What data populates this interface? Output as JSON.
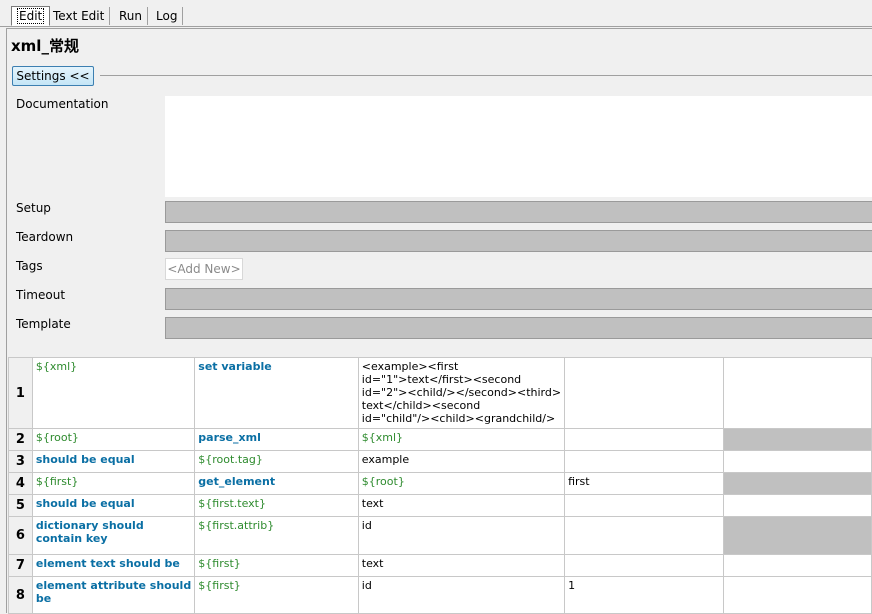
{
  "tabs": [
    {
      "label": "Edit",
      "active": true
    },
    {
      "label": "Text Edit",
      "active": false
    },
    {
      "label": "Run",
      "active": false
    },
    {
      "label": "Log",
      "active": false
    }
  ],
  "title": "xml_常规",
  "settings_button": "Settings <<",
  "fields": {
    "documentation": "Documentation",
    "setup": "Setup",
    "teardown": "Teardown",
    "tags": "Tags",
    "tags_placeholder": "<Add New>",
    "timeout": "Timeout",
    "template": "Template"
  },
  "colors": {
    "variable": "#2e8b2e",
    "keyword": "#0a6fa4",
    "empty_cell": "#c0c0c0"
  },
  "grid": {
    "rows": [
      {
        "num": "1",
        "cells": [
          {
            "text": "${xml}",
            "kind": "var"
          },
          {
            "text": "set variable",
            "kind": "kw"
          },
          {
            "text": "<example><first\nid=\"1\">text</first><second\nid=\"2\"><child/></second><third>\ntext</child><second\nid=\"child\"/><child><grandchild/>",
            "kind": "plain"
          },
          {
            "text": "",
            "kind": "empty"
          },
          {
            "text": "",
            "kind": "empty"
          }
        ]
      },
      {
        "num": "2",
        "cells": [
          {
            "text": "${root}",
            "kind": "var"
          },
          {
            "text": "parse_xml",
            "kind": "kw"
          },
          {
            "text": "${xml}",
            "kind": "var"
          },
          {
            "text": "",
            "kind": "empty"
          },
          {
            "text": "",
            "kind": "gray"
          }
        ]
      },
      {
        "num": "3",
        "cells": [
          {
            "text": "should be equal",
            "kind": "kw"
          },
          {
            "text": "${root.tag}",
            "kind": "var"
          },
          {
            "text": "example",
            "kind": "plain"
          },
          {
            "text": "",
            "kind": "empty"
          },
          {
            "text": "",
            "kind": "empty"
          }
        ]
      },
      {
        "num": "4",
        "cells": [
          {
            "text": "${first}",
            "kind": "var"
          },
          {
            "text": "get_element",
            "kind": "kw"
          },
          {
            "text": "${root}",
            "kind": "var"
          },
          {
            "text": "first",
            "kind": "plain"
          },
          {
            "text": "",
            "kind": "gray"
          }
        ]
      },
      {
        "num": "5",
        "cells": [
          {
            "text": "should be equal",
            "kind": "kw"
          },
          {
            "text": "${first.text}",
            "kind": "var"
          },
          {
            "text": "text",
            "kind": "plain"
          },
          {
            "text": "",
            "kind": "empty"
          },
          {
            "text": "",
            "kind": "empty"
          }
        ]
      },
      {
        "num": "6",
        "cells": [
          {
            "text": "dictionary should contain key",
            "kind": "kw"
          },
          {
            "text": "${first.attrib}",
            "kind": "var"
          },
          {
            "text": "id",
            "kind": "plain"
          },
          {
            "text": "",
            "kind": "empty"
          },
          {
            "text": "",
            "kind": "gray"
          }
        ]
      },
      {
        "num": "7",
        "cells": [
          {
            "text": "element text should be",
            "kind": "kw"
          },
          {
            "text": "${first}",
            "kind": "var"
          },
          {
            "text": "text",
            "kind": "plain"
          },
          {
            "text": "",
            "kind": "empty"
          },
          {
            "text": "",
            "kind": "empty"
          }
        ]
      },
      {
        "num": "8",
        "cells": [
          {
            "text": "element attribute should be",
            "kind": "kw"
          },
          {
            "text": "${first}",
            "kind": "var"
          },
          {
            "text": "id",
            "kind": "plain"
          },
          {
            "text": "1",
            "kind": "plain"
          },
          {
            "text": "",
            "kind": "empty"
          }
        ]
      }
    ]
  }
}
